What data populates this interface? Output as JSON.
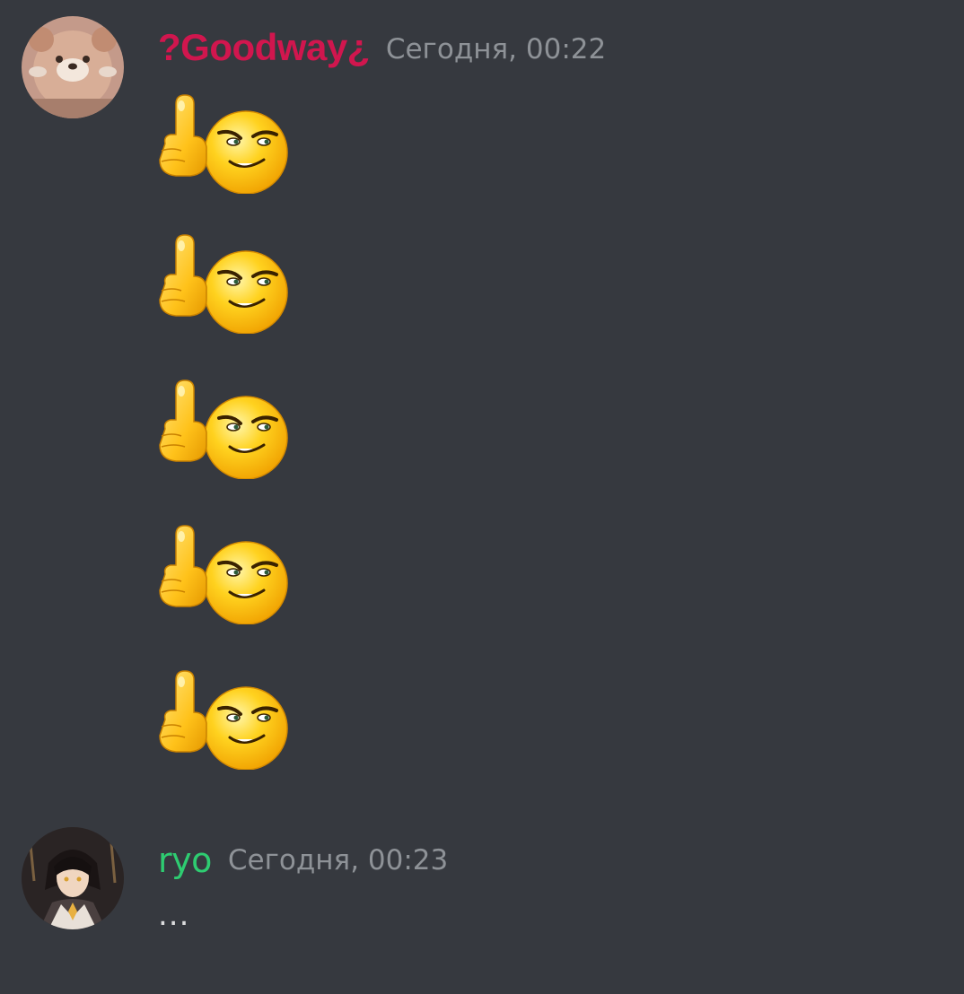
{
  "messages": [
    {
      "username": "?Goodway¿",
      "timestamp": "Сегодня, 00:22",
      "name_color": "#d1164e",
      "avatar": "bear-avatar",
      "content": {
        "type": "emoji",
        "emoji": "middle-finger-smirk-emoji",
        "count": 5
      }
    },
    {
      "username": "ryo",
      "timestamp": "Сегодня, 00:23",
      "name_color": "#2ecc71",
      "avatar": "anime-character-avatar",
      "content": {
        "type": "text",
        "text": "..."
      }
    }
  ],
  "colors": {
    "background": "#36393f",
    "timestamp": "#8e9297",
    "message_text": "#dcddde"
  }
}
